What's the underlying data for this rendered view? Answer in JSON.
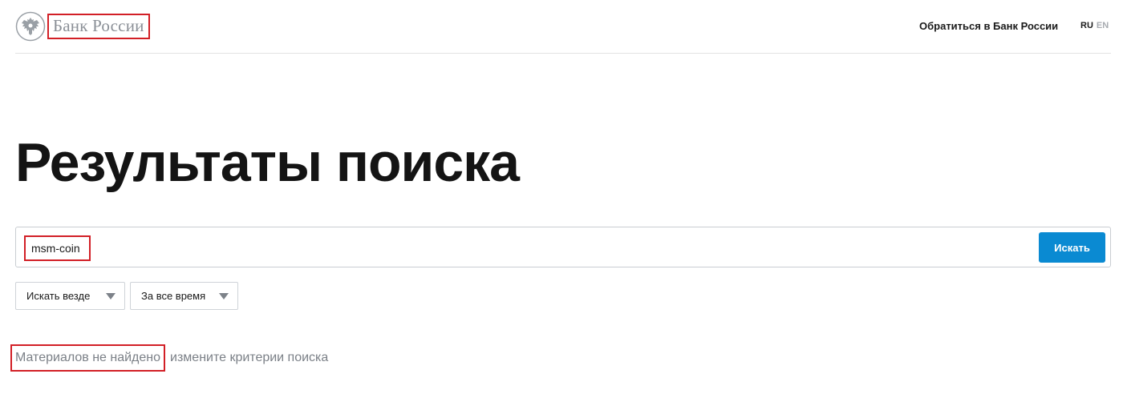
{
  "header": {
    "logo_name": "Банк России",
    "logo_icon": "double-headed-eagle-emblem",
    "contact_link": "Обратиться в Банк России",
    "lang_ru": "RU",
    "lang_en": "EN"
  },
  "main": {
    "title": "Результаты поиска",
    "search": {
      "value": "msm-coin",
      "button_label": "Искать"
    },
    "filters": {
      "where": "Искать везде",
      "when": "За все время"
    },
    "result": {
      "no_results": "Материалов не найдено",
      "hint": "измените критерии поиска"
    }
  },
  "colors": {
    "accent_blue": "#0a8ad2",
    "highlight_red": "#d21f26",
    "muted_gray": "#7b8087"
  }
}
